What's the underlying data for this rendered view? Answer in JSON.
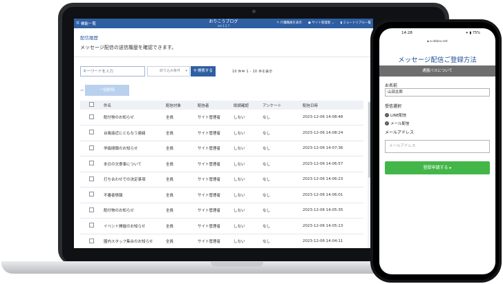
{
  "app": {
    "menu_label": "機能一覧",
    "brand": "おりこうブログ",
    "version": "ver.1.2.7",
    "tools": [
      "介護職員を表示",
      "サイト管理者",
      "ミュートリアル一覧"
    ]
  },
  "page": {
    "title": "配信履歴",
    "description": "メッセージ配信の送信履歴を確認できます。"
  },
  "search": {
    "placeholder": "キーワードを入力",
    "filter_label": "絞り込み条件",
    "button_label": "検索する",
    "count_text": "10 件中 1 - 10 件を表示"
  },
  "bulk_button_label": "一括削除",
  "table": {
    "headers": [
      "件名",
      "配信対象",
      "配信者",
      "既読確認",
      "アンケート",
      "配信日時"
    ],
    "rows": [
      {
        "subject": "配付物のお知らせ",
        "target": "全員",
        "sender": "サイト管理者",
        "read": "しない",
        "survey": "なし",
        "datetime": "2023-12-06 14:08:48"
      },
      {
        "subject": "台風接近にともなう連絡",
        "target": "全員",
        "sender": "サイト管理者",
        "read": "しない",
        "survey": "なし",
        "datetime": "2023-12-06 14:08:24"
      },
      {
        "subject": "学級閉鎖のお知らせ",
        "target": "全員",
        "sender": "サイト管理者",
        "read": "しない",
        "survey": "なし",
        "datetime": "2023-12-06 14:07:36"
      },
      {
        "subject": "本日の⽋食事について",
        "target": "全員",
        "sender": "サイト管理者",
        "read": "しない",
        "survey": "なし",
        "datetime": "2023-12-06 14:06:57"
      },
      {
        "subject": "打ち合わせでの決定事項",
        "target": "全員",
        "sender": "サイト管理者",
        "read": "しない",
        "survey": "なし",
        "datetime": "2023-12-06 14:06:23"
      },
      {
        "subject": "不審者情報",
        "target": "全員",
        "sender": "サイト管理者",
        "read": "しない",
        "survey": "なし",
        "datetime": "2023-12-06 14:06:01"
      },
      {
        "subject": "配付物のお知らせ",
        "target": "全員",
        "sender": "サイト管理者",
        "read": "しない",
        "survey": "なし",
        "datetime": "2023-12-06 14:05:35"
      },
      {
        "subject": "イベント開催のお知らせ",
        "target": "全員",
        "sender": "サイト管理者",
        "read": "しない",
        "survey": "なし",
        "datetime": "2023-12-06 14:05:13"
      },
      {
        "subject": "園内スタッフ集合のお知らせ",
        "target": "全員",
        "sender": "サイト管理者",
        "read": "しない",
        "survey": "なし",
        "datetime": "2023-12-06 14:04:11"
      }
    ]
  },
  "phone": {
    "time": "14:28",
    "status_right": "✦ ▮ 75%",
    "url": "a.dsbsv.net",
    "form_title": "メッセージ配信ご登録方法",
    "section_label": "通園バスについて",
    "name_label": "お名前",
    "name_value": "山田太郎",
    "receive_label": "受信選択",
    "options": [
      "LINE配信",
      "メール配信"
    ],
    "mail_label": "メールアドレス",
    "mail_placeholder": "メールアドレス",
    "submit_label": "登録申請する ▸"
  },
  "colors": {
    "accent": "#2f5fa3",
    "submit": "#43b649"
  }
}
